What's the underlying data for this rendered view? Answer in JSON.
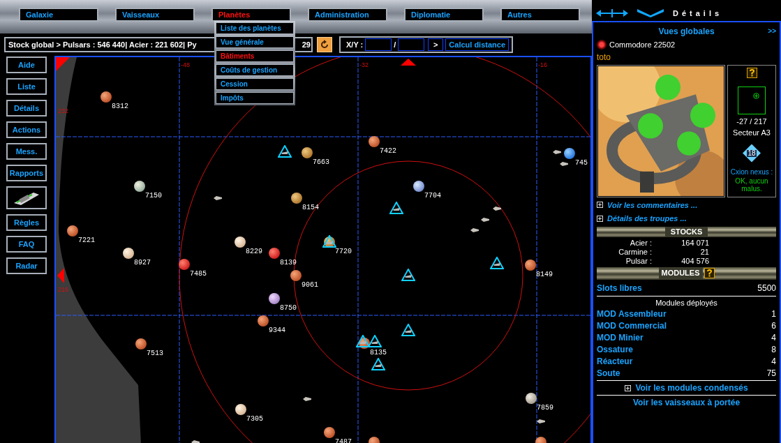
{
  "menu": {
    "tabs": [
      {
        "label": "Galaxie",
        "selected": false
      },
      {
        "label": "Vaisseaux",
        "selected": false
      },
      {
        "label": "Planètes",
        "selected": true
      },
      {
        "label": "Administration",
        "selected": false
      },
      {
        "label": "Diplomatie",
        "selected": false
      },
      {
        "label": "Autres",
        "selected": false
      }
    ],
    "dropdown": [
      {
        "label": "Liste des planètes",
        "selected": false
      },
      {
        "label": "Vue générale",
        "selected": false
      },
      {
        "label": "Bâtiments",
        "selected": true
      },
      {
        "label": "Coûts de gestion",
        "selected": false
      },
      {
        "label": "Cession",
        "selected": false
      },
      {
        "label": "Impôts",
        "selected": false
      }
    ]
  },
  "stock_bar": {
    "text_before": "Stock global > Pulsars : 546 440| Acier : 221 602| Py",
    "text_after": "29",
    "xy_label": "X/Y :",
    "separator": "/",
    "go": ">",
    "distance_button": "Calcul distance"
  },
  "sidebar": [
    {
      "kind": "text",
      "label": "Aide"
    },
    {
      "kind": "text",
      "label": "Liste"
    },
    {
      "kind": "text",
      "label": "Détails"
    },
    {
      "kind": "text",
      "label": "Actions"
    },
    {
      "kind": "text",
      "label": "Mess."
    },
    {
      "kind": "text",
      "label": "Rapports"
    },
    {
      "kind": "icon"
    },
    {
      "kind": "text",
      "label": "Règles"
    },
    {
      "kind": "text",
      "label": "FAQ"
    },
    {
      "kind": "text",
      "label": "Radar"
    }
  ],
  "map": {
    "x_labels": [
      "-48",
      "-32",
      "-16"
    ],
    "y_labels": [
      "232",
      "216"
    ],
    "planets": [
      {
        "label": "8312"
      },
      {
        "label": "7663"
      },
      {
        "label": "7422"
      },
      {
        "label": "745"
      },
      {
        "label": "7150"
      },
      {
        "label": "8154"
      },
      {
        "label": "7704"
      },
      {
        "label": "7221"
      },
      {
        "label": "8229"
      },
      {
        "label": "8139"
      },
      {
        "label": "7720"
      },
      {
        "label": "8927"
      },
      {
        "label": "7485"
      },
      {
        "label": "9061"
      },
      {
        "label": "8149"
      },
      {
        "label": "8750"
      },
      {
        "label": "9344"
      },
      {
        "label": "7513"
      },
      {
        "label": "8135"
      },
      {
        "label": "7859"
      },
      {
        "label": "7305"
      },
      {
        "label": "7487"
      }
    ]
  },
  "details": {
    "header_title": "Détails",
    "view_title": "Vues globales",
    "more": ">>",
    "commander": "Commodore 22502",
    "player": "toto",
    "coords": "-27 / 217",
    "sector": "Secteur A3",
    "badge": "18",
    "nexus_label": "Cxion nexus :",
    "nexus_status": "OK, aucun malus.",
    "links": [
      "Voir les commentaires ...",
      "Détails des troupes ..."
    ],
    "stocks": {
      "title": "STOCKS",
      "rows": [
        {
          "name": "Acier :",
          "value": "164 071"
        },
        {
          "name": "Carmine :",
          "value": "21"
        },
        {
          "name": "Pulsar :",
          "value": "404 576"
        }
      ]
    },
    "modules": {
      "title": "MODULES",
      "slots_label": "Slots libres",
      "slots_value": "5500",
      "deployed_title": "Modules déployés",
      "rows": [
        {
          "name": "MOD Assembleur",
          "value": "1"
        },
        {
          "name": "MOD Commercial",
          "value": "6"
        },
        {
          "name": "MOD Minier",
          "value": "4"
        },
        {
          "name": "Ossature",
          "value": "8"
        },
        {
          "name": "Réacteur",
          "value": "4"
        },
        {
          "name": "Soute",
          "value": "75"
        }
      ],
      "condensed_link": "Voir les modules condensés",
      "ships_link": "Voir les vaisseaux à portée"
    }
  }
}
